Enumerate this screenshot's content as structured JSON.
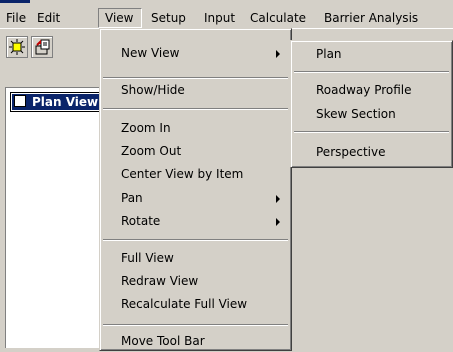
{
  "menubar": {
    "items": [
      {
        "label": "File"
      },
      {
        "label": "Edit"
      },
      {
        "label": "View"
      },
      {
        "label": "Setup"
      },
      {
        "label": "Input"
      },
      {
        "label": "Calculate"
      },
      {
        "label": "Barrier Analysis"
      }
    ]
  },
  "panel": {
    "tab_label": "Plan View"
  },
  "view_menu": {
    "items": [
      {
        "label": "New View"
      },
      {
        "label": "Show/Hide"
      },
      {
        "label": "Zoom In"
      },
      {
        "label": "Zoom Out"
      },
      {
        "label": "Center View by Item"
      },
      {
        "label": "Pan"
      },
      {
        "label": "Rotate"
      },
      {
        "label": "Full View"
      },
      {
        "label": "Redraw View"
      },
      {
        "label": "Recalculate Full View"
      },
      {
        "label": "Move Tool Bar"
      }
    ]
  },
  "new_view_submenu": {
    "items": [
      {
        "label": "Plan"
      },
      {
        "label": "Roadway Profile"
      },
      {
        "label": "Skew Section"
      },
      {
        "label": "Perspective"
      }
    ]
  },
  "icons": [
    "sun-icon",
    "open-file-icon"
  ],
  "colors": {
    "highlight": "#0a246a",
    "face": "#d4d0c8"
  }
}
